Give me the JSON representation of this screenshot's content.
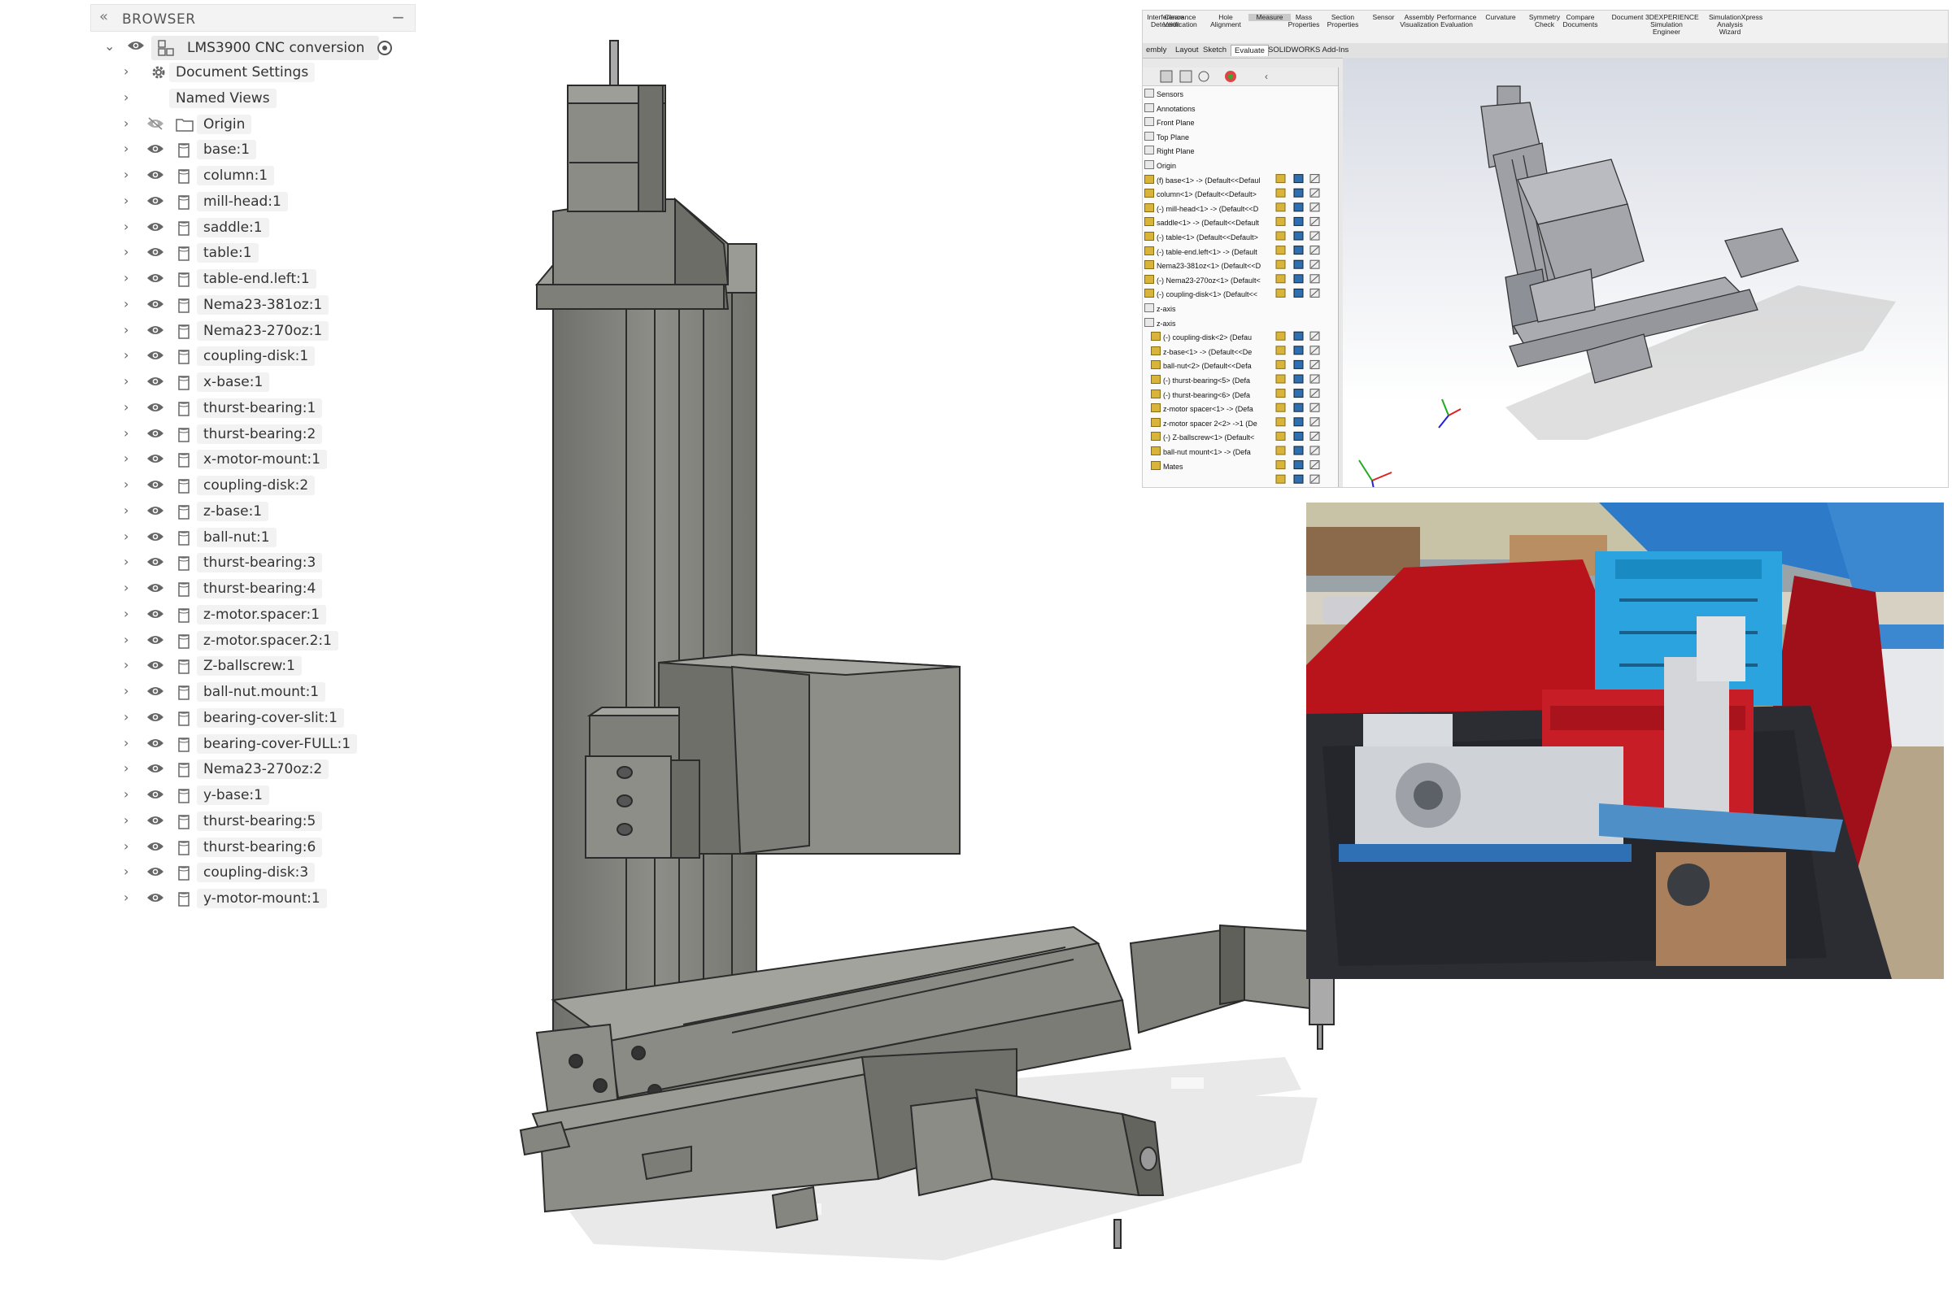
{
  "browser": {
    "title": "BROWSER",
    "root": "LMS3900 CNC conversion",
    "items": [
      {
        "label": "Document Settings",
        "icon": "gear-icon",
        "eye": false
      },
      {
        "label": "Named Views",
        "icon": "folder-icon",
        "eye": false
      },
      {
        "label": "Origin",
        "icon": "folder-icon",
        "eye": "hidden"
      },
      {
        "label": "base:1",
        "icon": "body-icon",
        "eye": true
      },
      {
        "label": "column:1",
        "icon": "body-icon",
        "eye": true
      },
      {
        "label": "mill-head:1",
        "icon": "body-icon",
        "eye": true
      },
      {
        "label": "saddle:1",
        "icon": "body-icon",
        "eye": true
      },
      {
        "label": "table:1",
        "icon": "body-icon",
        "eye": true
      },
      {
        "label": "table-end.left:1",
        "icon": "body-icon",
        "eye": true
      },
      {
        "label": "Nema23-381oz:1",
        "icon": "body-icon",
        "eye": true
      },
      {
        "label": "Nema23-270oz:1",
        "icon": "body-icon",
        "eye": true
      },
      {
        "label": "coupling-disk:1",
        "icon": "body-icon",
        "eye": true
      },
      {
        "label": "x-base:1",
        "icon": "body-icon",
        "eye": true
      },
      {
        "label": "thurst-bearing:1",
        "icon": "body-icon",
        "eye": true
      },
      {
        "label": "thurst-bearing:2",
        "icon": "body-icon",
        "eye": true
      },
      {
        "label": "x-motor-mount:1",
        "icon": "body-icon",
        "eye": true
      },
      {
        "label": "coupling-disk:2",
        "icon": "body-icon",
        "eye": true
      },
      {
        "label": "z-base:1",
        "icon": "body-icon",
        "eye": true
      },
      {
        "label": "ball-nut:1",
        "icon": "body-icon",
        "eye": true
      },
      {
        "label": "thurst-bearing:3",
        "icon": "body-icon",
        "eye": true
      },
      {
        "label": "thurst-bearing:4",
        "icon": "body-icon",
        "eye": true
      },
      {
        "label": "z-motor.spacer:1",
        "icon": "body-icon",
        "eye": true
      },
      {
        "label": "z-motor.spacer.2:1",
        "icon": "body-icon",
        "eye": true
      },
      {
        "label": "Z-ballscrew:1",
        "icon": "body-icon",
        "eye": true
      },
      {
        "label": "ball-nut.mount:1",
        "icon": "body-icon",
        "eye": true
      },
      {
        "label": "bearing-cover-slit:1",
        "icon": "body-icon",
        "eye": true
      },
      {
        "label": "bearing-cover-FULL:1",
        "icon": "body-icon",
        "eye": true
      },
      {
        "label": "Nema23-270oz:2",
        "icon": "body-icon",
        "eye": true
      },
      {
        "label": "y-base:1",
        "icon": "body-icon",
        "eye": true
      },
      {
        "label": "thurst-bearing:5",
        "icon": "body-icon",
        "eye": true
      },
      {
        "label": "thurst-bearing:6",
        "icon": "body-icon",
        "eye": true
      },
      {
        "label": "coupling-disk:3",
        "icon": "body-icon",
        "eye": true
      },
      {
        "label": "y-motor-mount:1",
        "icon": "body-icon",
        "eye": true
      }
    ]
  },
  "solidworks": {
    "toolbar": [
      "Interference Detection",
      "Clearance Verification",
      "Hole Alignment",
      "Measure",
      "Mass Properties",
      "Section Properties",
      "Sensor",
      "Assembly Visualization",
      "Performance Evaluation",
      "Curvature",
      "Symmetry Check",
      "Compare Documents",
      "Document",
      "3DEXPERIENCE Simulation Engineer",
      "SimulationXpress Analysis Wizard"
    ],
    "tabs": [
      "embly",
      "Layout",
      "Sketch",
      "Evaluate",
      "SOLIDWORKS Add-Ins"
    ],
    "tree": [
      "Sensors",
      "Annotations",
      "Front Plane",
      "Top Plane",
      "Right Plane",
      "Origin",
      "(f) base<1> -> (Default<<Defaul",
      "column<1> (Default<<Default>",
      "(-) mill-head<1> -> (Default<<D",
      "saddle<1> -> (Default<<Default",
      "(-) table<1> (Default<<Default>",
      "(-) table-end.left<1> -> (Default",
      "Nema23-381oz<1> (Default<<D",
      "(-) Nema23-270oz<1> (Default<",
      "(-) coupling-disk<1> (Default<<",
      "z-axis",
      "z-axis",
      "(-) coupling-disk<2> (Defau",
      "z-base<1> -> (Default<<De",
      "ball-nut<2> (Default<<Defa",
      "(-) thurst-bearing<5> (Defa",
      "(-) thurst-bearing<6> (Defa",
      "z-motor spacer<1> -> (Defa",
      "z-motor spacer 2<2> ->1 (De",
      "(-) Z-ballscrew<1> (Default<",
      "ball-nut mount<1> -> (Defa",
      "Mates"
    ]
  },
  "colors": {
    "part": "#8b8c86",
    "part_dark": "#5f605b",
    "part_light": "#a7a8a2",
    "shadow": "#e6e6e6",
    "accent": "#3a7bd5"
  }
}
